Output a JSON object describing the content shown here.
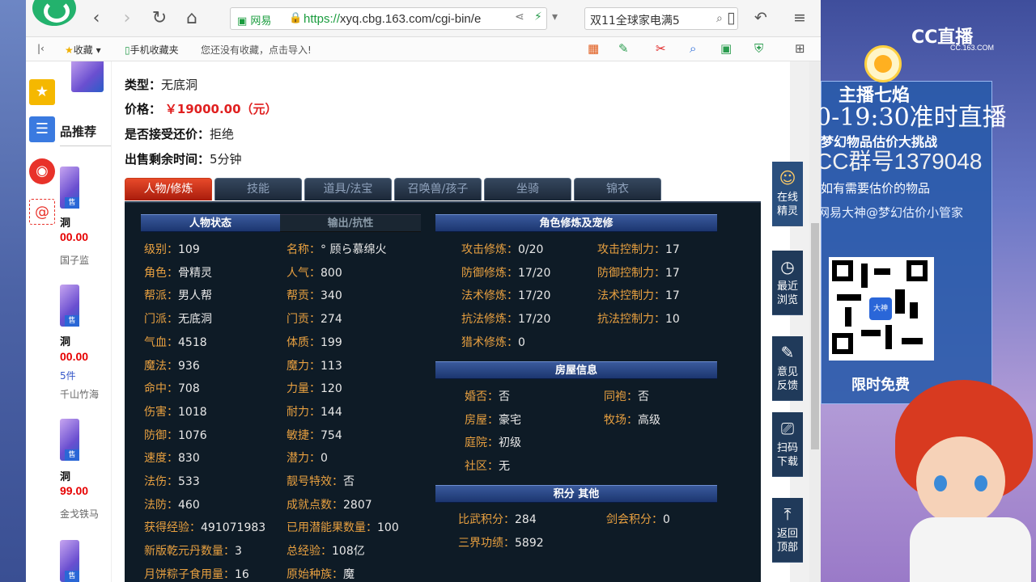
{
  "browser": {
    "url_prefix": "https://",
    "url_rest": "xyq.cbg.163.com/cgi-bin/e",
    "cert_label": "网易",
    "search_text": "双11全球家电满5"
  },
  "bookmarks": {
    "favorites": "收藏",
    "mobile": "手机收藏夹",
    "hint": "您还没有收藏，点击导入!"
  },
  "item": {
    "type_label": "类型：",
    "type_value": "无底洞",
    "price_label": "价格：",
    "price_value": "￥19000.00（元）",
    "bargain_label": "是否接受还价：",
    "bargain_value": "拒绝",
    "time_label": "出售剩余时间：",
    "time_value": "5分钟"
  },
  "recommend": {
    "title": "品推荐",
    "items": [
      {
        "name": "洞",
        "price": "00.00",
        "server": "国子监"
      },
      {
        "name": "洞",
        "price": "00.00",
        "count": "5件",
        "server": "千山竹海"
      },
      {
        "name": "洞",
        "price": "99.00",
        "server": "金戈铁马"
      }
    ],
    "sale": "售"
  },
  "tabs": [
    "人物/修炼",
    "技能",
    "道具/法宝",
    "召唤兽/孩子",
    "坐骑",
    "锦衣"
  ],
  "panel": {
    "hdr_status": "人物状态",
    "hdr_output": "输出/抗性",
    "hdr_cultivation": "角色修炼及宠修",
    "hdr_house": "房屋信息",
    "hdr_points": "积分 其他",
    "left": [
      [
        "级别：",
        "109"
      ],
      [
        "角色：",
        "骨精灵"
      ],
      [
        "帮派：",
        "男人帮"
      ],
      [
        "门派：",
        "无底洞"
      ],
      [
        "气血：",
        "4518"
      ],
      [
        "魔法：",
        "936"
      ],
      [
        "命中：",
        "708"
      ],
      [
        "伤害：",
        "1018"
      ],
      [
        "防御：",
        "1076"
      ],
      [
        "速度：",
        "830"
      ],
      [
        "法伤：",
        "533"
      ],
      [
        "法防：",
        "460"
      ],
      [
        "获得经验：",
        "491071983"
      ],
      [
        "新版乾元丹数量：",
        "3"
      ],
      [
        "月饼粽子食用量：",
        "16"
      ]
    ],
    "mid": [
      [
        "名称：",
        "° 顾ら慕绵火"
      ],
      [
        "人气：",
        "800"
      ],
      [
        "帮贡：",
        "340"
      ],
      [
        "门贡：",
        "274"
      ],
      [
        "体质：",
        "199"
      ],
      [
        "魔力：",
        "113"
      ],
      [
        "力量：",
        "120"
      ],
      [
        "耐力：",
        "144"
      ],
      [
        "敏捷：",
        "754"
      ],
      [
        "潜力：",
        "0"
      ],
      [
        "靓号特效：",
        "否"
      ],
      [
        "成就点数：",
        "2807"
      ],
      [
        "已用潜能果数量：",
        "100"
      ],
      [
        "总经验：",
        "108亿"
      ],
      [
        "原始种族：",
        "魔"
      ]
    ],
    "cult_left": [
      [
        "攻击修炼：",
        "0/20"
      ],
      [
        "防御修炼：",
        "17/20"
      ],
      [
        "法术修炼：",
        "17/20"
      ],
      [
        "抗法修炼：",
        "17/20"
      ],
      [
        "猎术修炼：",
        "0"
      ]
    ],
    "cult_right": [
      [
        "攻击控制力：",
        "17"
      ],
      [
        "防御控制力：",
        "17"
      ],
      [
        "法术控制力：",
        "17"
      ],
      [
        "抗法控制力：",
        "10"
      ]
    ],
    "house_left": [
      [
        "婚否：",
        "否"
      ],
      [
        "房屋：",
        "豪宅"
      ],
      [
        "庭院：",
        "初级"
      ],
      [
        "社区：",
        "无"
      ]
    ],
    "house_right": [
      [
        "同袍：",
        "否"
      ],
      [
        "牧场：",
        "高级"
      ]
    ],
    "points_left": [
      [
        "比武积分：",
        "284"
      ],
      [
        "三界功绩：",
        "5892"
      ]
    ],
    "points_right": [
      [
        "剑会积分：",
        "0"
      ]
    ]
  },
  "float": [
    {
      "label1": "在线",
      "label2": "精灵"
    },
    {
      "label1": "最近",
      "label2": "浏览"
    },
    {
      "label1": "意见",
      "label2": "反馈"
    },
    {
      "label1": "扫码",
      "label2": "下载"
    },
    {
      "label1": "返回",
      "label2": "顶部"
    }
  ],
  "stream": {
    "logo": "CC直播",
    "logo_sub": "CC.163.COM",
    "anchor": "主播七焰",
    "line1": "0-19:30准时直播",
    "line2": "梦幻物品估价大挑战",
    "line3": "CC群号1379048",
    "line4": "如有需要估价的物品",
    "line5": "网易大神@梦幻估价小管家",
    "qr_center": "大神",
    "free": "限时免费"
  },
  "colors": {
    "accent_red": "#e02020",
    "panel_bg": "#0e1b26",
    "key_orange": "#e8a040"
  }
}
